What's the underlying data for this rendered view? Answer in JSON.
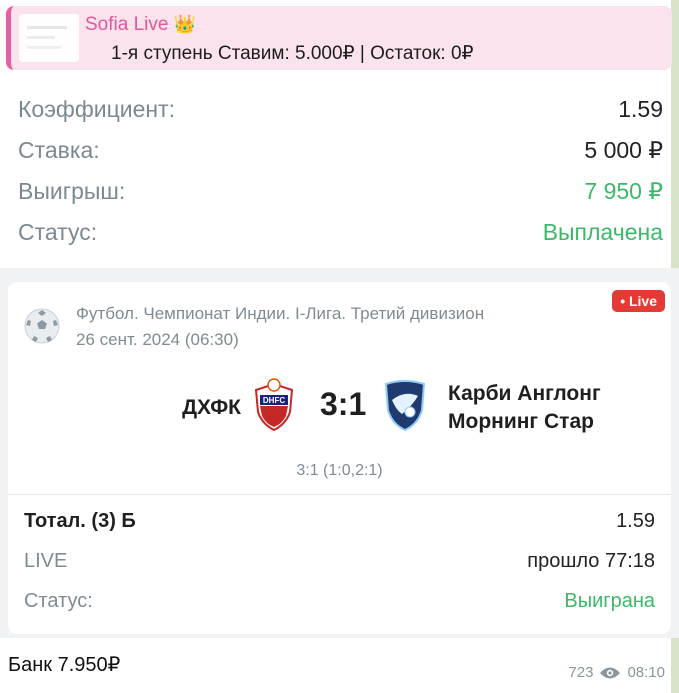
{
  "quote": {
    "author": "Sofia Live",
    "crown_icon": "👑",
    "text": "1-я ступень Ставим: 5.000₽ | Остаток: 0₽",
    "accent": "#ea5ea2"
  },
  "bet": {
    "rows": [
      {
        "label": "Коэффициент:",
        "value": "1.59"
      },
      {
        "label": "Ставка:",
        "value": "5 000 ₽"
      },
      {
        "label": "Выигрыш:",
        "value": "7 950 ₽"
      },
      {
        "label": "Статус:",
        "value": "Выплачена"
      }
    ],
    "green": "#3cb868"
  },
  "match": {
    "sport_icon": "football-icon",
    "league": "Футбол. Чемпионат Индии. I-Лига. Третий дивизион",
    "date": "26 сент. 2024 (06:30)",
    "live_badge": "• Live",
    "team1": "ДХФК",
    "team1_logo_text": "DHFC",
    "score": "3:1",
    "team2_line1": "Карби Англонг",
    "team2_line2": "Морнинг Стар",
    "halves": "3:1 (1:0,2:1)",
    "market_label": "Тотал. (3) Б",
    "market_value": "1.59",
    "live_label": "LIVE",
    "live_value": "прошло 77:18",
    "status_label": "Статус:",
    "status_value": "Выиграна",
    "live_color": "#e53935"
  },
  "footer": {
    "bank": "Банк 7.950₽",
    "views": "723",
    "time": "08:10"
  }
}
